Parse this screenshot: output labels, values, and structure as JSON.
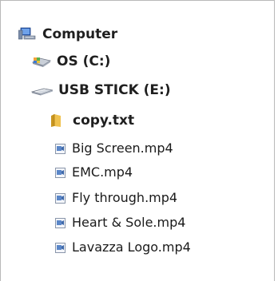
{
  "tree": {
    "computer": {
      "label": "Computer",
      "icon": "computer-icon"
    },
    "os_drive": {
      "label": "OS (C:)",
      "icon": "hard-drive-icon"
    },
    "usb_drive": {
      "label": "USB STICK (E:)",
      "icon": "usb-drive-icon"
    },
    "folder": {
      "label": "copy.txt",
      "icon": "folder-icon"
    },
    "files": [
      {
        "label": "Big Screen.mp4",
        "icon": "video-file-icon"
      },
      {
        "label": "EMC.mp4",
        "icon": "video-file-icon"
      },
      {
        "label": "Fly through.mp4",
        "icon": "video-file-icon"
      },
      {
        "label": "Heart & Sole.mp4",
        "icon": "video-file-icon"
      },
      {
        "label": "Lavazza Logo.mp4",
        "icon": "video-file-icon"
      }
    ]
  },
  "colors": {
    "folder": "#e8b84a",
    "drive_blue": "#3a7bd5",
    "border": "#b9b9b9"
  }
}
